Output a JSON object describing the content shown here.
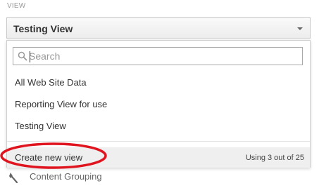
{
  "section": {
    "label": "VIEW"
  },
  "view_select": {
    "selected": "Testing View",
    "arrow_icon": "caret-down-icon"
  },
  "dropdown": {
    "search": {
      "value": "",
      "placeholder": "Search",
      "icon": "search-icon"
    },
    "items": [
      {
        "label": "All Web Site Data"
      },
      {
        "label": "Reporting View for use"
      },
      {
        "label": "Testing View"
      }
    ],
    "footer": {
      "create_label": "Create new view",
      "usage_text": "Using 3 out of 25"
    }
  },
  "annotation": {
    "color": "#e0141e"
  },
  "below": {
    "label": "Content Grouping",
    "icon": "content-grouping-icon"
  },
  "colors": {
    "footer_bg": "#efefef",
    "text": "#333333"
  }
}
